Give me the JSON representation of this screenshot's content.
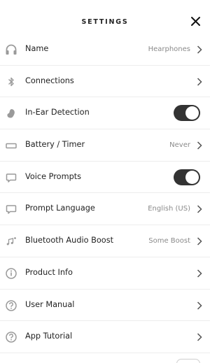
{
  "header": {
    "title": "SETTINGS",
    "close_icon": "close-icon"
  },
  "rows": [
    {
      "label": "Name",
      "value": "Hearphones",
      "icon": "headphones-icon",
      "control": "chevron"
    },
    {
      "label": "Connections",
      "value": "",
      "icon": "bluetooth-icon",
      "control": "chevron"
    },
    {
      "label": "In-Ear Detection",
      "value": "",
      "icon": "ear-icon",
      "control": "toggle",
      "on": true
    },
    {
      "label": "Battery / Timer",
      "value": "Never",
      "icon": "battery-icon",
      "control": "chevron"
    },
    {
      "label": "Voice Prompts",
      "value": "",
      "icon": "speech-bubble-icon",
      "control": "toggle",
      "on": true
    },
    {
      "label": "Prompt Language",
      "value": "English (US)",
      "icon": "speech-bubble-icon",
      "control": "chevron"
    },
    {
      "label": "Bluetooth Audio Boost",
      "value": "Some Boost",
      "icon": "music-note-icon",
      "control": "chevron"
    },
    {
      "label": "Product Info",
      "value": "",
      "icon": "info-icon",
      "control": "chevron"
    },
    {
      "label": "User Manual",
      "value": "",
      "icon": "help-icon",
      "control": "chevron"
    },
    {
      "label": "App Tutorial",
      "value": "",
      "icon": "help-icon",
      "control": "chevron"
    }
  ],
  "colors": {
    "text": "#222222",
    "secondary_text": "#8a8a8a",
    "icon": "#9a9a9a",
    "toggle_on": "#333333",
    "divider": "#ededed",
    "background": "#ffffff"
  }
}
